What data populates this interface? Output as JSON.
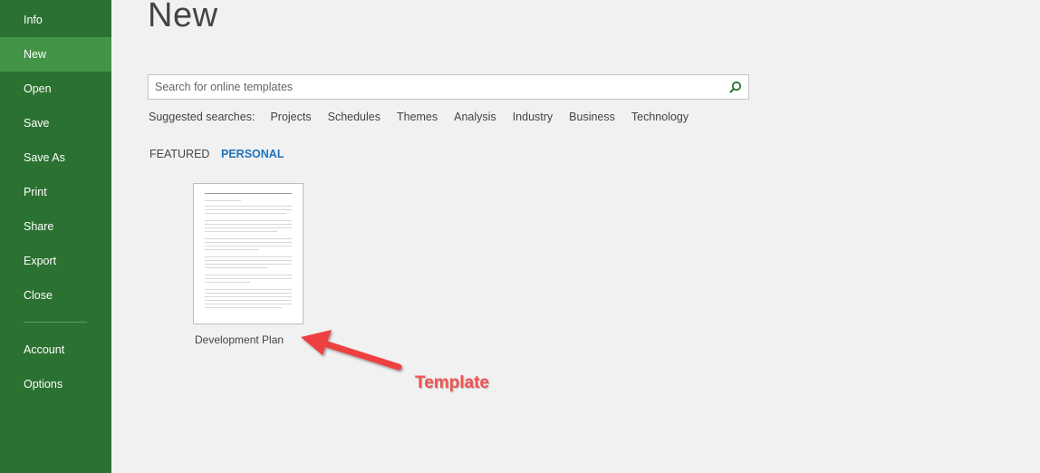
{
  "sidebar": {
    "items": [
      {
        "label": "Info"
      },
      {
        "label": "New"
      },
      {
        "label": "Open"
      },
      {
        "label": "Save"
      },
      {
        "label": "Save As"
      },
      {
        "label": "Print"
      },
      {
        "label": "Share"
      },
      {
        "label": "Export"
      },
      {
        "label": "Close"
      },
      {
        "label": "Account"
      },
      {
        "label": "Options"
      }
    ],
    "active": "New"
  },
  "main": {
    "title": "New",
    "search": {
      "placeholder": "Search for online templates",
      "button_icon": "search-icon"
    },
    "suggested": {
      "label": "Suggested searches:",
      "links": [
        "Projects",
        "Schedules",
        "Themes",
        "Analysis",
        "Industry",
        "Business",
        "Technology"
      ]
    },
    "tabs": [
      {
        "label": "FEATURED",
        "active": false
      },
      {
        "label": "PERSONAL",
        "active": true
      }
    ],
    "templates": [
      {
        "name": "Development Plan"
      }
    ]
  },
  "annotation": {
    "label": "Template",
    "color": "#f25252"
  },
  "colors": {
    "sidebar": "#2b7131",
    "sidebar_active": "#439446",
    "accent_link": "#1e73be",
    "background": "#f1f1f1"
  }
}
